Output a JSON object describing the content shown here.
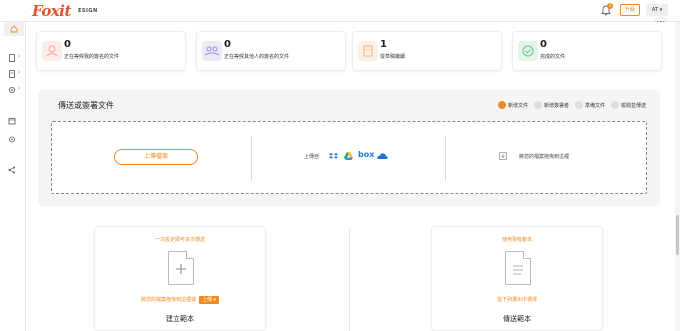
{
  "app": {
    "logo": "Foxit",
    "logo_sub": "ESIGN"
  },
  "topbar": {
    "badge": "1",
    "upgrade_label": "升級",
    "user_initials": "AT ▾",
    "wps_label": "W"
  },
  "sidebar": {
    "items": [
      {
        "icon": "home-icon"
      },
      {
        "icon": "document-icon",
        "chev": "›"
      },
      {
        "icon": "template-icon",
        "chev": "›"
      },
      {
        "icon": "settings-icon",
        "chev": "›"
      },
      {
        "icon": "calendar-icon"
      },
      {
        "icon": "location-icon"
      },
      {
        "icon": "share-icon"
      }
    ]
  },
  "status_cards": [
    {
      "count": "0",
      "label": "正在等候我的簽名的文件",
      "color": "#f4a7a0",
      "bg": "#fdecea"
    },
    {
      "count": "0",
      "label": "正在等候其他人的簽名的文件",
      "color": "#9b8fdc",
      "bg": "#ece9fa"
    },
    {
      "count": "1",
      "label": "從草稿繼續",
      "color": "#f0b37a",
      "bg": "#fdf0e4"
    },
    {
      "count": "0",
      "label": "完成的文件",
      "color": "#6cc38a",
      "bg": "#e4f5ea"
    }
  ],
  "send_panel": {
    "title": "傳送或簽署文件",
    "actions": [
      {
        "label": "新增文件",
        "primary": true
      },
      {
        "label": "新增簽署者",
        "primary": false
      },
      {
        "label": "準備文件",
        "primary": false
      },
      {
        "label": "檢閱並傳送",
        "primary": false
      }
    ],
    "upload_label": "上傳檔案",
    "from_label": "上傳自",
    "services": [
      "dropbox",
      "google-drive",
      "box",
      "onedrive"
    ],
    "box_label": "box",
    "drag_label": "將您的檔案拖曳到這裡"
  },
  "templates": [
    {
      "top": "一次設定即可多次傳送",
      "hint": "將您的檔案拖曳到這裡或",
      "button": "上傳 ▾",
      "name": "建立範本"
    },
    {
      "top": "使用現有範本",
      "hint": "從下列選出中選擇",
      "name": "傳送範本"
    }
  ]
}
